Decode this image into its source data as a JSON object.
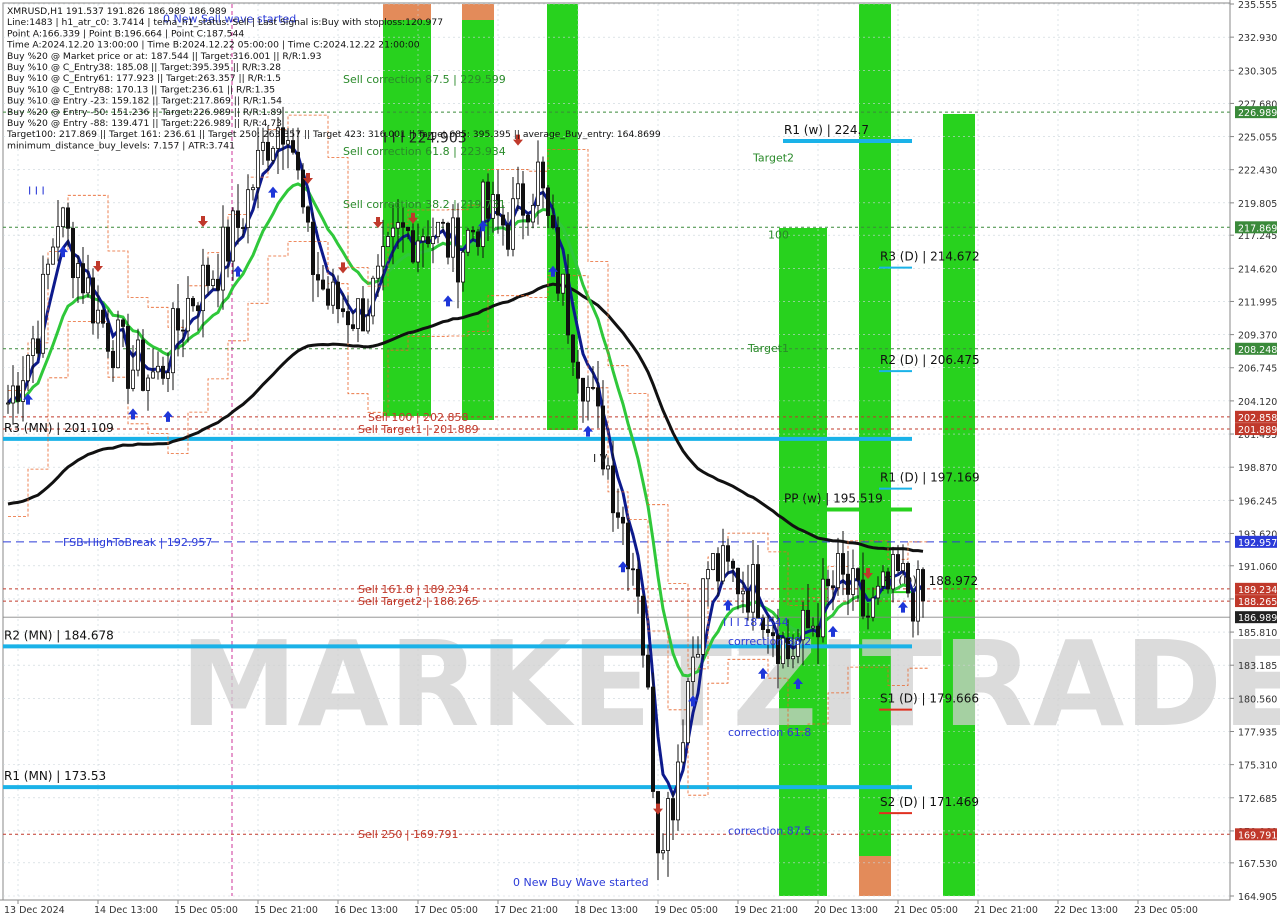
{
  "info_panel": {
    "lines": [
      "XMRUSD,H1  191.537 191.826 186.989 186.989",
      "Line:1483  |  h1_atr_c0: 3.7414  |  tema_h1_status: Sell  |  Last Signal is:Buy with stoploss:120.977",
      "Point A:166.339  |  Point B:196.664  |  Point C:187.544",
      "Time A:2024.12.20 13:00:00  |  Time B:2024.12.22 05:00:00  |  Time C:2024.12.22 21:00:00",
      "Buy %20 @ Market price or at: 187.544  ||  Target:316.001  ||  R/R:1.93",
      "Buy %10 @ C_Entry38: 185.08  ||  Target:395.395  ||  R/R:3.28",
      "Buy %10 @ C_Entry61: 177.923  ||  Target:263.357  ||  R/R:1.5",
      "Buy %10 @ C_Entry88: 170.13  ||  Target:236.61  ||  R/R:1.35",
      "Buy %10 @ Entry -23: 159.182  ||  Target:217.869  ||  R/R:1.54",
      "Buy %20 @ Entry -50: 151.236  ||  Target:226.989  ||  R/R:1.89",
      "Buy %20 @ Entry -88: 139.471  ||  Target:226.989  ||  R/R:4.73",
      "Target100: 217.869  ||  Target 161: 236.61  ||  Target 250: 263.357  ||  Target 423: 316.001  ||  Target 685: 395.395  ||  average_Buy_entry: 164.8699",
      "minimum_distance_buy_levels: 7.157  |  ATR:3.741"
    ]
  },
  "colors": {
    "background": "#ffffff",
    "grid": "#c9d3da",
    "blue_level": "#1ab2e8",
    "green_zone": "#28d21e",
    "orange_zone": "#e38b5a",
    "ma_green": "#2fc83a",
    "ma_navy": "#0d1a8c",
    "ma_black": "#111111",
    "sell_red": "#c0392b",
    "buy_blue": "#1e36d8",
    "dashed_blue": "#2b3bd8",
    "dashed_red": "#c0392b",
    "dashed_green": "#3a8a3a"
  },
  "watermark": "MARKETZITRADE",
  "chart_data": {
    "type": "candlestick",
    "symbol": "XMRUSD",
    "timeframe": "H1",
    "ylim": [
      164.905,
      235.555
    ],
    "x_ticks": [
      "13 Dec 2024",
      "14 Dec 13:00",
      "15 Dec 05:00",
      "15 Dec 21:00",
      "16 Dec 13:00",
      "17 Dec 05:00",
      "17 Dec 21:00",
      "18 Dec 13:00",
      "19 Dec 05:00",
      "19 Dec 21:00",
      "20 Dec 13:00",
      "21 Dec 05:00",
      "21 Dec 21:00",
      "22 Dec 13:00",
      "23 Dec 05:00"
    ],
    "y_ticks": [
      "235.555",
      "232.930",
      "230.305",
      "227.680",
      "225.055",
      "222.430",
      "219.805",
      "217.245",
      "214.620",
      "211.995",
      "209.370",
      "206.745",
      "204.120",
      "201.495",
      "198.870",
      "196.245",
      "193.620",
      "191.060",
      "188.435",
      "185.810",
      "183.185",
      "180.560",
      "177.935",
      "175.310",
      "172.685",
      "170.060",
      "167.530",
      "164.905"
    ],
    "price_tags": [
      {
        "label": "226.989",
        "value": 226.989,
        "color": "#3a8a3a"
      },
      {
        "label": "217.869",
        "value": 217.869,
        "color": "#3a8a3a"
      },
      {
        "label": "208.248",
        "value": 208.248,
        "color": "#3a8a3a"
      },
      {
        "label": "202.858",
        "value": 202.858,
        "color": "#c0392b"
      },
      {
        "label": "201.889",
        "value": 201.889,
        "color": "#c0392b"
      },
      {
        "label": "192.957",
        "value": 192.957,
        "color": "#2b3bd8"
      },
      {
        "label": "189.234",
        "value": 189.234,
        "color": "#c0392b"
      },
      {
        "label": "188.265",
        "value": 188.265,
        "color": "#c0392b"
      },
      {
        "label": "186.989",
        "value": 186.989,
        "color": "#222222"
      },
      {
        "label": "169.791",
        "value": 169.791,
        "color": "#c0392b"
      }
    ],
    "levels": [
      {
        "label": "R3 (MN) | 201.109",
        "value": 201.109,
        "color": "#1ab2e8"
      },
      {
        "label": "R2 (MN) | 184.678",
        "value": 184.678,
        "color": "#1ab2e8"
      },
      {
        "label": "R1 (MN) | 173.53",
        "value": 173.53,
        "color": "#1ab2e8"
      },
      {
        "label": "R1 (w) | 224.7",
        "value": 224.7,
        "color": "#1ab2e8"
      },
      {
        "label": "PP (w) | 195.519",
        "value": 195.519,
        "color": "#28d21e"
      },
      {
        "label": "R3 (D) | 214.672",
        "value": 214.672,
        "color": "#1ab2e8"
      },
      {
        "label": "R2 (D) | 206.475",
        "value": 206.475,
        "color": "#1ab2e8"
      },
      {
        "label": "R1 (D) | 197.169",
        "value": 197.169,
        "color": "#1ab2e8"
      },
      {
        "label": "PP (D) | 188.972",
        "value": 188.972,
        "color": "#28d21e"
      },
      {
        "label": "S1 (D) | 179.666",
        "value": 179.666,
        "color": "#e03020"
      },
      {
        "label": "S2 (D) | 171.469",
        "value": 171.469,
        "color": "#e03020"
      }
    ],
    "annotations": [
      {
        "text": "0 New Sell wave started",
        "color": "#2b3bd8",
        "x": 31,
        "y": 234.4
      },
      {
        "text": "Sell correction 87.5 | 229.599",
        "color": "#2a8a2a",
        "x": 67,
        "y": 229.6
      },
      {
        "text": "I I I 224.903",
        "color": "#222222",
        "x": 75,
        "y": 224.9
      },
      {
        "text": "Sell correction 61.8 | 223.934",
        "color": "#2a8a2a",
        "x": 67,
        "y": 223.9
      },
      {
        "text": "Sell correction 38.2 | 219.731",
        "color": "#2a8a2a",
        "x": 67,
        "y": 219.7
      },
      {
        "text": "Sell 100 | 202.858",
        "color": "#c0392b",
        "x": 72,
        "y": 202.86
      },
      {
        "text": "Sell Target1 | 201.889",
        "color": "#c0392b",
        "x": 70,
        "y": 201.89
      },
      {
        "text": "I V",
        "color": "#222222",
        "x": 117,
        "y": 199.6
      },
      {
        "text": "FSB-HighToBreak | 192.957",
        "color": "#2b3bd8",
        "x": 11,
        "y": 192.96
      },
      {
        "text": "Sell 161.8 | 189.234",
        "color": "#c0392b",
        "x": 70,
        "y": 189.23
      },
      {
        "text": "Sell Target2 | 188.265",
        "color": "#c0392b",
        "x": 70,
        "y": 188.27
      },
      {
        "text": "I I I 187.544",
        "color": "#2b3bd8",
        "x": 143,
        "y": 186.6
      },
      {
        "text": "correction 38.2",
        "color": "#2b3bd8",
        "x": 144,
        "y": 185.1
      },
      {
        "text": "correction 61.8",
        "color": "#2b3bd8",
        "x": 144,
        "y": 177.9
      },
      {
        "text": "Sell  250 | 169.791",
        "color": "#c0392b",
        "x": 70,
        "y": 169.8
      },
      {
        "text": "correction 87.5",
        "color": "#2b3bd8",
        "x": 144,
        "y": 170.1
      },
      {
        "text": "0 New Buy Wave started",
        "color": "#2b3bd8",
        "x": 101,
        "y": 166.0
      },
      {
        "text": "Target2",
        "color": "#2a8a2a",
        "x": 149,
        "y": 223.4
      },
      {
        "text": "100",
        "color": "#2a8a2a",
        "x": 152,
        "y": 217.3
      },
      {
        "text": "Target1",
        "color": "#2a8a2a",
        "x": 148,
        "y": 208.3
      },
      {
        "text": "I I I",
        "color": "#2b3bd8",
        "x": 4,
        "y": 220.8
      }
    ]
  }
}
